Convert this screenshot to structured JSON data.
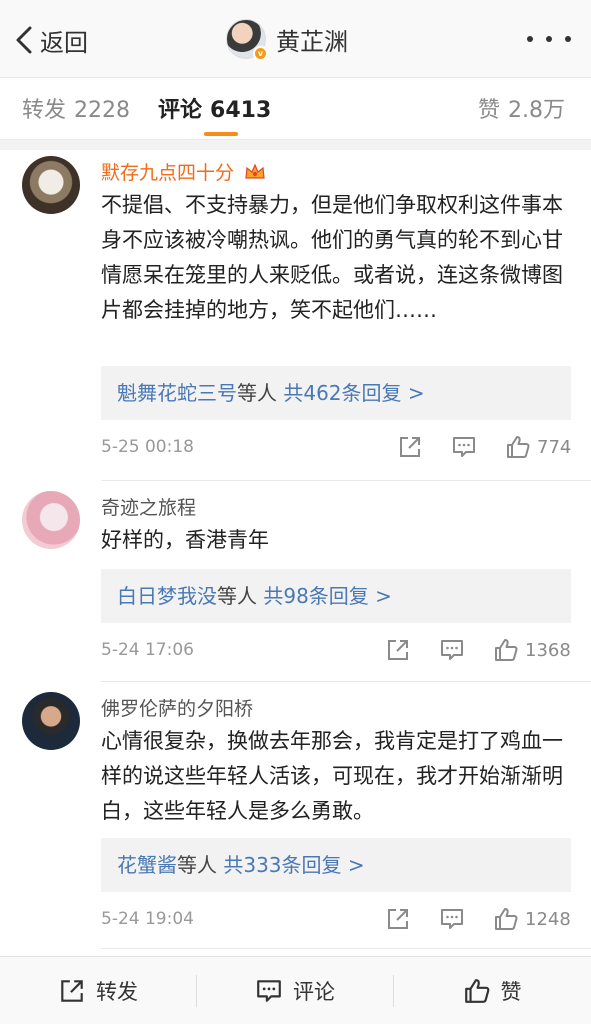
{
  "header": {
    "back_label": "返回",
    "title": "黄芷渊",
    "verified_badge": "v"
  },
  "tabs": {
    "repost_label": "转发",
    "repost_count": "2228",
    "comment_label": "评论",
    "comment_count": "6413",
    "like_label": "赞",
    "like_count": "2.8万"
  },
  "comments": [
    {
      "username": "默存九点四十分",
      "text": "不提倡、不支持暴力，但是他们争取权利这件事本身不应该被冷嘲热讽。他们的勇气真的轮不到心甘情愿呆在笼里的人来贬低。或者说，连这条微博图片都会挂掉的地方，笑不起他们……",
      "reply_users": "魁舞花蛇三号",
      "reply_etc": "等人",
      "reply_total": "共462条回复 >",
      "time": "5-25 00:18",
      "likes": "774"
    },
    {
      "username": "奇迹之旅程",
      "text": "好样的，香港青年",
      "reply_users": "白日梦我没",
      "reply_etc": "等人",
      "reply_total": "共98条回复 >",
      "time": "5-24 17:06",
      "likes": "1368"
    },
    {
      "username": "佛罗伦萨的夕阳桥",
      "text": "心情很复杂，换做去年那会，我肯定是打了鸡血一样的说这些年轻人活该，可现在，我才开始渐渐明白，这些年轻人是多么勇敢。",
      "reply_users": "花蟹酱",
      "reply_etc": "等人",
      "reply_total": "共333条回复 >",
      "time": "5-24 19:04",
      "likes": "1248"
    }
  ],
  "bottom_bar": {
    "repost": "转发",
    "comment": "评论",
    "like": "赞"
  },
  "colors": {
    "accent_orange": "#f78c1e",
    "username_highlight": "#f26b1b",
    "link_blue": "#4a78b4"
  },
  "icons": [
    "chevron-left-icon",
    "more-dots-icon",
    "crown-icon",
    "repost-icon",
    "comment-icon",
    "thumbs-up-icon"
  ]
}
